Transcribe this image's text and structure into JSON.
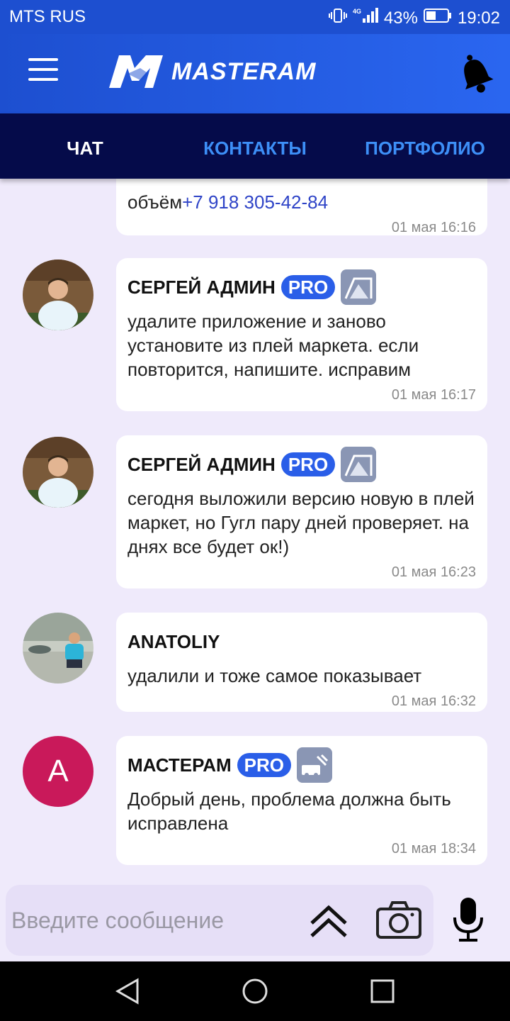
{
  "status_bar": {
    "carrier": "MTS RUS",
    "network": "4G",
    "battery": "43%",
    "time": "19:02"
  },
  "app_bar": {
    "logo_text": "MASTERAM",
    "menu_icon": "hamburger-menu-icon",
    "bell_icon": "bell-icon"
  },
  "tabs": [
    {
      "label": "ЧАТ",
      "active": true
    },
    {
      "label": "КОНТАКТЫ",
      "active": false
    },
    {
      "label": "ПОРТФОЛИО",
      "active": false
    }
  ],
  "partial_message": {
    "text": "объём",
    "phone": "+7 918 305-42-84",
    "time": "01 мая 16:16"
  },
  "messages": [
    {
      "sender": "СЕРГЕЙ АДМИН",
      "pro": "PRO",
      "text": "удалите приложение и заново установите из плей маркета. если повторится, напишите. исправим",
      "time": "01 мая 16:17"
    },
    {
      "sender": "СЕРГЕЙ АДМИН",
      "pro": "PRO",
      "text": "сегодня выложили версию новую в плей маркет, но Гугл пару дней проверяет. на днях все будет ок!)",
      "time": "01 мая 16:23"
    },
    {
      "sender": "ANATOLIY",
      "text": "удалили и тоже самое показывает",
      "time": "01 мая 16:32"
    },
    {
      "sender": "МАСТЕРАМ",
      "pro": "PRO",
      "avatar_letter": "A",
      "text": "Добрый день, проблема должна быть исправлена",
      "time": "01 мая 18:34"
    }
  ],
  "input": {
    "placeholder": "Введите сообщение"
  },
  "colors": {
    "app_bar": "#1d4fd0",
    "tabs_bg": "#050b4a",
    "tab_inactive": "#3d8ff7",
    "pro_badge": "#2a5ee8",
    "avatar_letter_bg": "#c9195a",
    "chat_bg": "#efeafb"
  }
}
